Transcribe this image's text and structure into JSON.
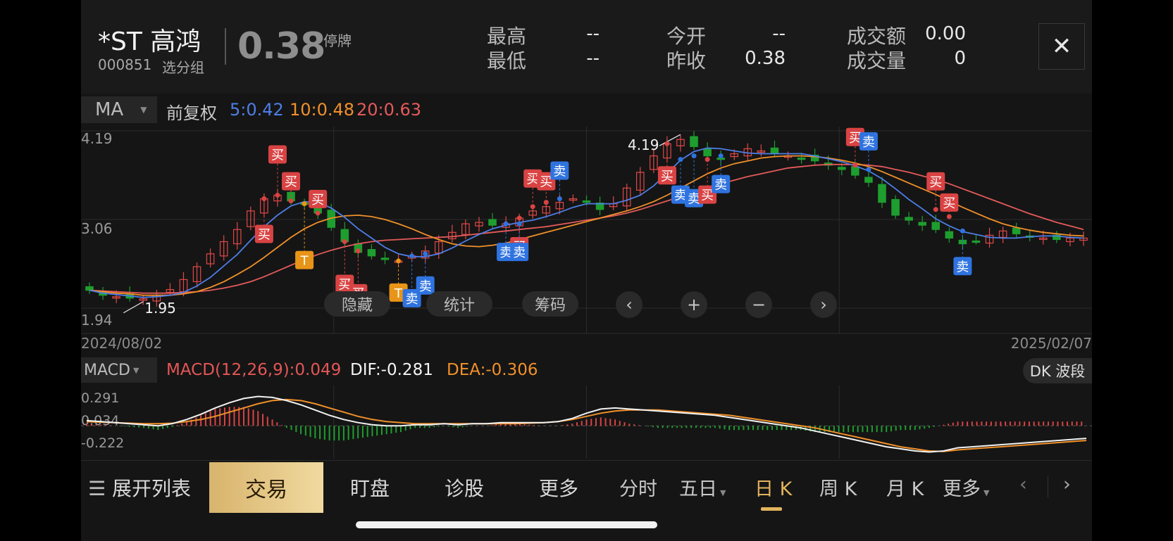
{
  "header": {
    "stock_name": "*ST 高鸿",
    "stock_code": "000851",
    "group_label": "选分组",
    "price": "0.38",
    "status": "停牌",
    "stats": {
      "high_label": "最高",
      "high_value": "--",
      "low_label": "最低",
      "low_value": "--",
      "open_label": "今开",
      "open_value": "--",
      "prev_close_label": "昨收",
      "prev_close_value": "0.38",
      "turnover_label": "成交额",
      "turnover_value": "0.00",
      "volume_label": "成交量",
      "volume_value": "0"
    },
    "close_icon": "close-icon"
  },
  "ma_bar": {
    "indicator": "MA",
    "adjust": "前复权",
    "ma5": "5:0.42",
    "ma10": "10:0.48",
    "ma20": "20:0.63",
    "colors": {
      "ma5": "#4d7ee6",
      "ma10": "#f0902a",
      "ma20": "#e45a5a"
    }
  },
  "overlay_buttons": {
    "hide": "隐藏",
    "stats": "统计",
    "chips": "筹码",
    "prev_icon": "chevron-left-icon",
    "zoom_in_icon": "plus-icon",
    "zoom_out_icon": "minus-icon",
    "next_icon": "chevron-right-icon"
  },
  "signals": {
    "buy": "买",
    "sell": "卖",
    "t": "T"
  },
  "chart_data": [
    {
      "type": "candlestick",
      "title": "",
      "price_axis_labels": [
        "4.19",
        "3.06",
        "1.94"
      ],
      "ylim": [
        1.82,
        4.3
      ],
      "x_start_label": "2024/08/02",
      "x_end_label": "2025/02/07",
      "max_marker": "4.19",
      "min_marker": "1.95",
      "up_color": "#e04848",
      "down_color": "#1e9e2e",
      "series_names": [
        "MA5",
        "MA10",
        "MA20"
      ],
      "close": [
        2.07,
        2.0,
        1.98,
        1.96,
        1.95,
        2.0,
        2.08,
        2.22,
        2.4,
        2.58,
        2.75,
        2.92,
        3.18,
        3.35,
        3.4,
        3.32,
        3.28,
        3.15,
        2.95,
        2.75,
        2.6,
        2.55,
        2.5,
        2.48,
        2.55,
        2.62,
        2.75,
        2.88,
        3.0,
        3.02,
        2.98,
        3.0,
        3.08,
        3.18,
        3.24,
        3.3,
        3.35,
        3.32,
        3.2,
        3.28,
        3.5,
        3.72,
        3.95,
        4.12,
        4.18,
        4.08,
        3.95,
        3.9,
        3.98,
        4.05,
        4.02,
        3.98,
        3.95,
        3.92,
        3.88,
        3.82,
        3.76,
        3.68,
        3.58,
        3.3,
        3.12,
        3.05,
        2.98,
        2.92,
        2.8,
        2.72,
        2.76,
        2.84,
        2.9,
        2.86,
        2.82,
        2.8,
        2.78,
        2.8,
        2.8
      ],
      "ma5": [
        2.07,
        2.03,
        2.01,
        1.99,
        1.97,
        1.98,
        2.0,
        2.04,
        2.13,
        2.25,
        2.41,
        2.57,
        2.77,
        2.96,
        3.12,
        3.25,
        3.31,
        3.3,
        3.22,
        3.09,
        2.93,
        2.8,
        2.67,
        2.58,
        2.54,
        2.54,
        2.58,
        2.66,
        2.76,
        2.85,
        2.93,
        2.98,
        3.02,
        3.05,
        3.1,
        3.16,
        3.23,
        3.28,
        3.28,
        3.28,
        3.33,
        3.4,
        3.53,
        3.71,
        3.89,
        4.01,
        4.06,
        4.05,
        4.02,
        3.99,
        3.98,
        3.98,
        3.98,
        3.98,
        3.95,
        3.91,
        3.87,
        3.81,
        3.74,
        3.63,
        3.49,
        3.34,
        3.21,
        3.07,
        2.97,
        2.89,
        2.85,
        2.81,
        2.8,
        2.8,
        2.82,
        2.83,
        2.83,
        2.81,
        2.8
      ],
      "ma10": [
        2.07,
        2.05,
        2.03,
        2.02,
        2.0,
        2.0,
        2.0,
        2.02,
        2.05,
        2.11,
        2.19,
        2.29,
        2.4,
        2.53,
        2.67,
        2.81,
        2.93,
        3.02,
        3.08,
        3.11,
        3.12,
        3.1,
        3.06,
        3.0,
        2.93,
        2.85,
        2.78,
        2.72,
        2.69,
        2.68,
        2.7,
        2.73,
        2.78,
        2.83,
        2.88,
        2.93,
        2.98,
        3.03,
        3.08,
        3.13,
        3.18,
        3.24,
        3.31,
        3.4,
        3.5,
        3.6,
        3.7,
        3.78,
        3.84,
        3.88,
        3.92,
        3.94,
        3.95,
        3.95,
        3.94,
        3.92,
        3.89,
        3.85,
        3.8,
        3.73,
        3.65,
        3.57,
        3.49,
        3.41,
        3.32,
        3.23,
        3.15,
        3.07,
        3.0,
        2.95,
        2.91,
        2.88,
        2.86,
        2.84,
        2.83
      ],
      "ma20": [
        2.07,
        2.06,
        2.05,
        2.04,
        2.03,
        2.03,
        2.03,
        2.04,
        2.05,
        2.07,
        2.1,
        2.14,
        2.19,
        2.26,
        2.34,
        2.42,
        2.5,
        2.57,
        2.63,
        2.68,
        2.72,
        2.75,
        2.77,
        2.78,
        2.79,
        2.8,
        2.81,
        2.82,
        2.84,
        2.86,
        2.88,
        2.9,
        2.92,
        2.94,
        2.96,
        2.99,
        3.02,
        3.05,
        3.08,
        3.11,
        3.15,
        3.2,
        3.26,
        3.32,
        3.38,
        3.44,
        3.5,
        3.56,
        3.61,
        3.66,
        3.7,
        3.74,
        3.78,
        3.8,
        3.82,
        3.83,
        3.83,
        3.83,
        3.82,
        3.8,
        3.76,
        3.72,
        3.67,
        3.62,
        3.56,
        3.49,
        3.42,
        3.35,
        3.28,
        3.21,
        3.14,
        3.08,
        3.02,
        2.97,
        2.92
      ]
    },
    {
      "type": "bar",
      "title": "",
      "indicator": "MACD(12,26,9)",
      "axis_labels": [
        "0.291",
        "0.034",
        "-0.222"
      ],
      "ylim": [
        -0.26,
        0.33
      ],
      "series_names": [
        "DIF",
        "DEA",
        "MACD"
      ],
      "dif": [
        0.05,
        0.04,
        0.03,
        0.02,
        0.01,
        0.0,
        0.02,
        0.06,
        0.11,
        0.17,
        0.22,
        0.26,
        0.28,
        0.27,
        0.24,
        0.2,
        0.15,
        0.1,
        0.06,
        0.03,
        0.01,
        0.0,
        0.0,
        0.01,
        0.01,
        0.02,
        0.01,
        0.02,
        0.02,
        0.03,
        0.03,
        0.03,
        0.03,
        0.04,
        0.07,
        0.12,
        0.16,
        0.17,
        0.16,
        0.15,
        0.14,
        0.13,
        0.12,
        0.11,
        0.1,
        0.08,
        0.06,
        0.04,
        0.02,
        0.0,
        -0.02,
        -0.05,
        -0.08,
        -0.11,
        -0.14,
        -0.17,
        -0.2,
        -0.22,
        -0.24,
        -0.25,
        -0.24,
        -0.21,
        -0.2,
        -0.19,
        -0.18,
        -0.17,
        -0.16,
        -0.15,
        -0.14,
        -0.13,
        -0.12
      ],
      "dea": [
        0.04,
        0.035,
        0.03,
        0.025,
        0.02,
        0.02,
        0.025,
        0.04,
        0.06,
        0.09,
        0.13,
        0.17,
        0.21,
        0.24,
        0.25,
        0.24,
        0.21,
        0.17,
        0.13,
        0.09,
        0.06,
        0.04,
        0.03,
        0.02,
        0.02,
        0.02,
        0.02,
        0.02,
        0.02,
        0.02,
        0.02,
        0.025,
        0.03,
        0.04,
        0.06,
        0.09,
        0.12,
        0.14,
        0.15,
        0.15,
        0.15,
        0.14,
        0.13,
        0.12,
        0.11,
        0.1,
        0.08,
        0.06,
        0.04,
        0.02,
        0.0,
        -0.02,
        -0.05,
        -0.08,
        -0.11,
        -0.14,
        -0.17,
        -0.2,
        -0.22,
        -0.24,
        -0.245,
        -0.23,
        -0.22,
        -0.21,
        -0.2,
        -0.19,
        -0.18,
        -0.17,
        -0.16,
        -0.15,
        -0.14
      ],
      "macd": "2*(DIF-DEA)",
      "current": {
        "macd": "MACD(12,26,9):0.049",
        "dif": "DIF:-0.281",
        "dea": "DEA:-0.306"
      },
      "dk_label": "DK 波段"
    }
  ],
  "toolbar": {
    "expand_icon": "list-icon",
    "expand_label": "展开列表",
    "trade": "交易",
    "watch": "盯盘",
    "diagnose": "诊股",
    "more": "更多",
    "tf_intraday": "分时",
    "tf_5day": "五日",
    "tf_day": "日 K",
    "tf_week": "周 K",
    "tf_month": "月 K",
    "tf_more": "更多",
    "prev_icon": "chevron-left-icon",
    "next_icon": "chevron-right-icon"
  }
}
